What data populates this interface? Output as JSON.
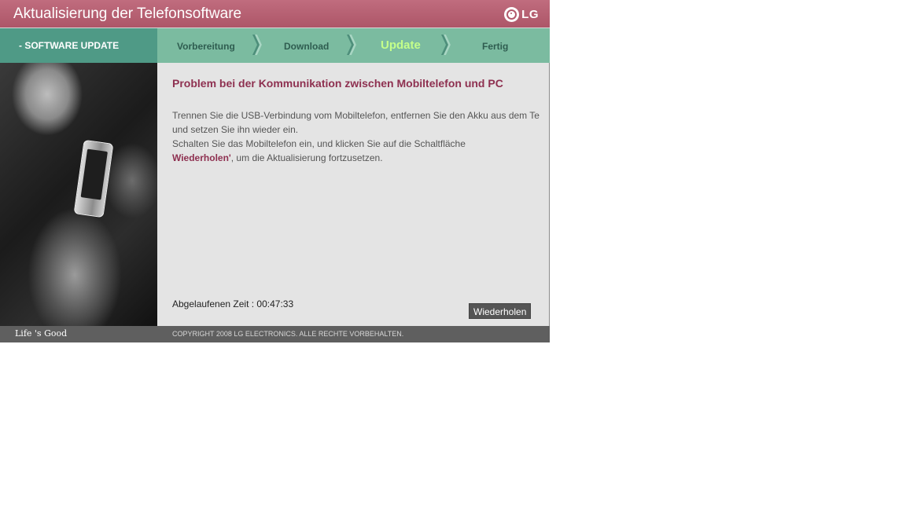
{
  "window": {
    "title": "Aktualisierung der Telefonsoftware",
    "logo_text": "LG",
    "logo_icon": "lg-logo-icon"
  },
  "sidebar": {
    "label": "- SOFTWARE UPDATE"
  },
  "steps": [
    {
      "label": "Vorbereitung",
      "active": false
    },
    {
      "label": "Download",
      "active": false
    },
    {
      "label": "Update",
      "active": true
    },
    {
      "label": "Fertig",
      "active": false
    }
  ],
  "content": {
    "heading": "Problem bei der Kommunikation zwischen Mobiltelefon und PC",
    "line1": "Trennen Sie die USB-Verbindung vom Mobiltelefon, entfernen Sie den Akku aus dem Te",
    "line2": "und setzen Sie ihn wieder ein.",
    "line3": "Schalten Sie das Mobiltelefon ein, und klicken Sie auf die Schaltfläche",
    "line4_bold": "Wiederholen'",
    "line4_rest": ", um die Aktualisierung fortzusetzen.",
    "elapsed_label": "Abgelaufenen Zeit : ",
    "elapsed_value": "00:47:33",
    "retry_label": "Wiederholen"
  },
  "footer": {
    "slogan": "Life 's Good",
    "copyright": "COPYRIGHT 2008  LG ELECTRONICS. ALLE RECHTE VORBEHALTEN."
  },
  "colors": {
    "title_bar": "#b86071",
    "step_bar": "#7bbba0",
    "step_active": "#c4ff8a",
    "heading": "#8e3050",
    "footer": "#5f5f5f"
  }
}
